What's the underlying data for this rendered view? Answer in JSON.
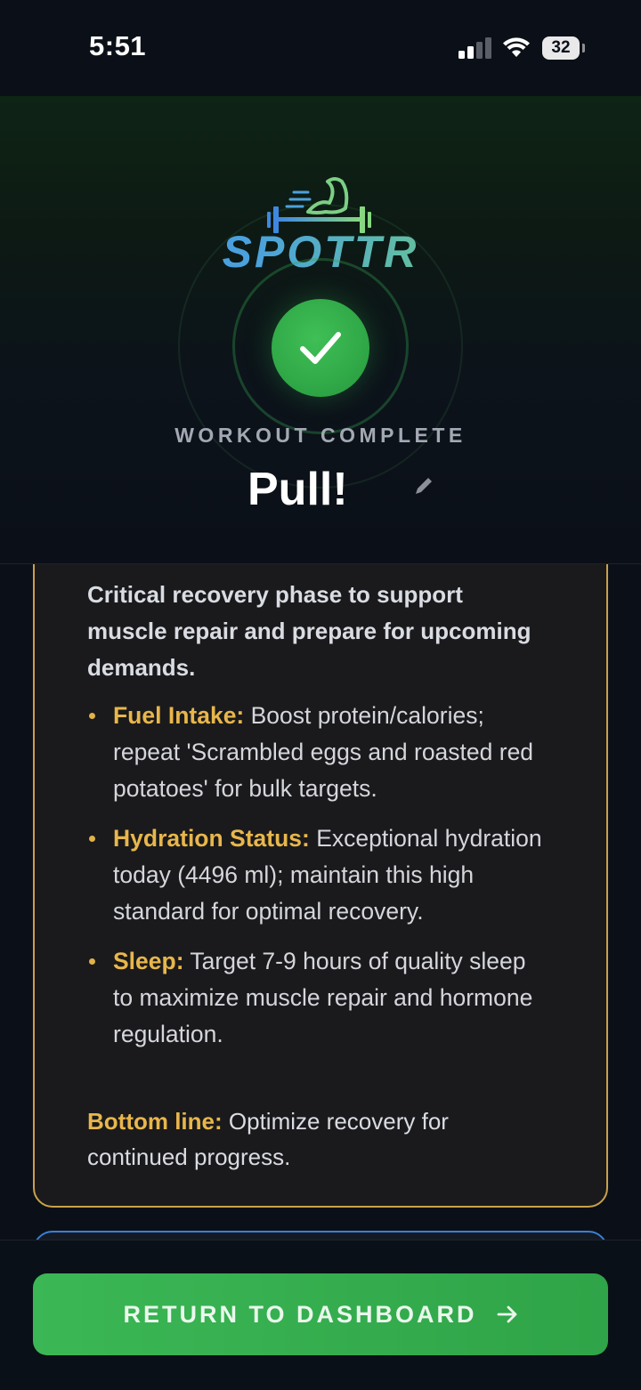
{
  "status_bar": {
    "time": "5:51",
    "battery": "32"
  },
  "header": {
    "brand": "SPOTTR",
    "eyebrow": "WORKOUT COMPLETE",
    "workout_title": "Pull!"
  },
  "recovery_card": {
    "intro": "Critical recovery phase to support muscle repair and prepare for upcoming demands.",
    "items": [
      {
        "label": "Fuel Intake:",
        "text": " Boost protein/calories; repeat 'Scrambled eggs and roasted red potatoes' for bulk targets."
      },
      {
        "label": "Hydration Status:",
        "text": " Exceptional hydration today (4496 ml); maintain this high standard for optimal recovery."
      },
      {
        "label": "Sleep:",
        "text": " Target 7-9 hours of quality sleep to maximize muscle repair and hormone regulation."
      }
    ],
    "bottom_label": "Bottom line:",
    "bottom_text": " Optimize recovery for continued progress."
  },
  "footer": {
    "button_label": "RETURN TO DASHBOARD"
  },
  "colors": {
    "accent_green": "#2fa448",
    "gold": "#e8b64b",
    "blue_border": "#3b7fd6"
  },
  "icons": [
    "signal-icon",
    "wifi-icon",
    "battery-icon",
    "dumbbell-arm-icon",
    "checkmark-icon",
    "pencil-icon",
    "arrow-right-icon"
  ]
}
